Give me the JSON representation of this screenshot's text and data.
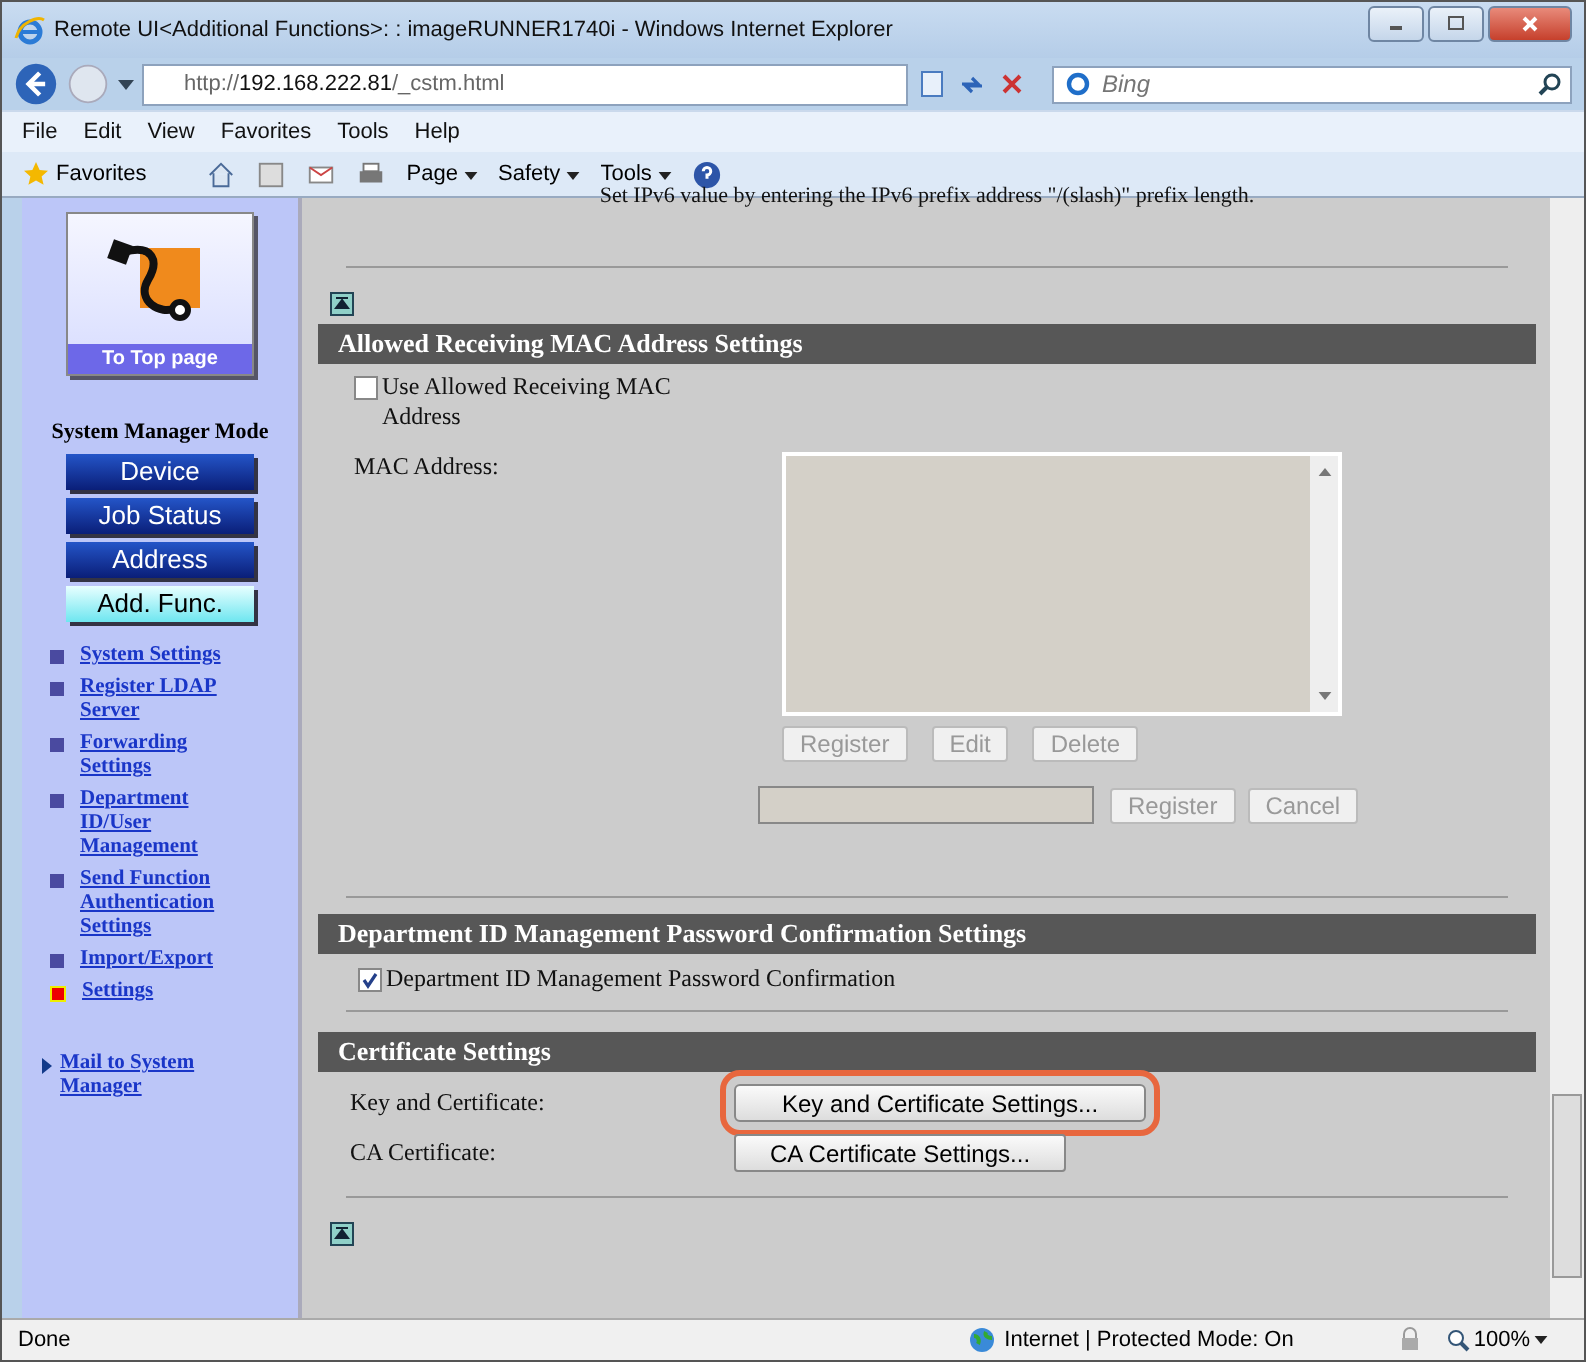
{
  "window": {
    "title": "Remote UI<Additional Functions>: : imageRUNNER1740i - Windows Internet Explorer"
  },
  "address_bar": {
    "url_prefix": "http://",
    "url_host": "192.168.222.81",
    "url_path": "/_cstm.html"
  },
  "search": {
    "placeholder": "Bing"
  },
  "menu": [
    "File",
    "Edit",
    "View",
    "Favorites",
    "Tools",
    "Help"
  ],
  "favorites_bar": {
    "favorites": "Favorites",
    "menus": [
      "Page",
      "Safety",
      "Tools"
    ]
  },
  "sidebar": {
    "top_link": "To Top page",
    "mode_label": "System Manager Mode",
    "nav_buttons": [
      {
        "label": "Device",
        "selected": false
      },
      {
        "label": "Job Status",
        "selected": false
      },
      {
        "label": "Address",
        "selected": false
      },
      {
        "label": "Add. Func.",
        "selected": true
      }
    ],
    "links": [
      {
        "label": "System Settings",
        "selected": false
      },
      {
        "label": "Register LDAP Server",
        "selected": false
      },
      {
        "label": "Forwarding Settings",
        "selected": false
      },
      {
        "label": "Department ID/User Management",
        "selected": false
      },
      {
        "label": "Send Function Authentication Settings",
        "selected": false
      },
      {
        "label": "Import/Export",
        "selected": false
      },
      {
        "label": "Settings",
        "selected": true
      }
    ],
    "mail_link": "Mail to System Manager"
  },
  "intro_text": "Set IPv6 value by entering the IPv6 prefix address \"/(slash)\" prefix length.",
  "mac_section": {
    "title": "Allowed Receiving MAC Address Settings",
    "checkbox": {
      "label": "Use Allowed Receiving MAC Address",
      "checked": false
    },
    "list_label": "MAC Address:",
    "list_buttons": [
      {
        "label": "Register",
        "disabled": true
      },
      {
        "label": "Edit",
        "disabled": true
      },
      {
        "label": "Delete",
        "disabled": true
      }
    ],
    "entry_buttons": [
      {
        "label": "Register",
        "disabled": true
      },
      {
        "label": "Cancel",
        "disabled": true
      }
    ]
  },
  "dept_section": {
    "title": "Department ID Management Password Confirmation Settings",
    "checkbox": {
      "label": "Department ID Management Password Confirmation",
      "checked": true
    }
  },
  "cert_section": {
    "title": "Certificate Settings",
    "rows": [
      {
        "label": "Key and Certificate:",
        "button": "Key and Certificate Settings...",
        "highlighted": true
      },
      {
        "label": "CA Certificate:",
        "button": "CA Certificate Settings...",
        "highlighted": false
      }
    ]
  },
  "status_bar": {
    "status": "Done",
    "zone": "Internet | Protected Mode: On",
    "zoom": "100%"
  }
}
